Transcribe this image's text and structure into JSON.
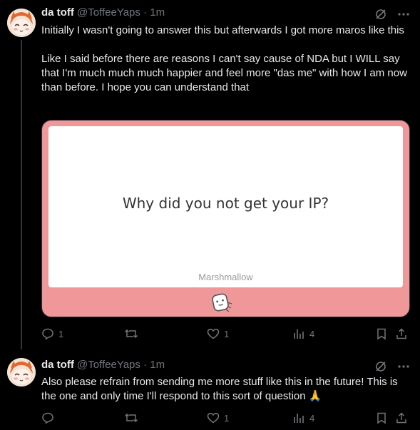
{
  "tweets": [
    {
      "author_name": "da toff",
      "handle": "@ToffeeYaps",
      "separator": "·",
      "time": "1m",
      "text_p1": "Initially I wasn't going to answer this but afterwards I got more maros like this",
      "text_p2": "Like I said before there are reasons I can't say cause of NDA but I WILL say that I'm much much much happier and feel more \"das me\" with how I am now than before. I hope you can understand that",
      "card": {
        "question": "Why did you not get your IP?",
        "brand": "Marshmallow",
        "background_color": "#f0979a"
      },
      "actions": {
        "replies": "1",
        "reposts": "",
        "likes": "1",
        "views": "4"
      }
    },
    {
      "author_name": "da toff",
      "handle": "@ToffeeYaps",
      "separator": "·",
      "time": "1m",
      "text_p1": "Also please refrain from sending me more stuff like this in the future! This is the one and only time I'll respond to this sort of question 🙏",
      "actions": {
        "replies": "",
        "reposts": "",
        "likes": "1",
        "views": "4"
      }
    }
  ],
  "icons": {
    "grok": "grok-slash-icon",
    "more": "more-dots-icon",
    "reply": "reply-bubble-icon",
    "repost": "repost-arrows-icon",
    "like": "heart-icon",
    "views": "views-bars-icon",
    "bookmark": "bookmark-icon",
    "share": "share-icon"
  }
}
